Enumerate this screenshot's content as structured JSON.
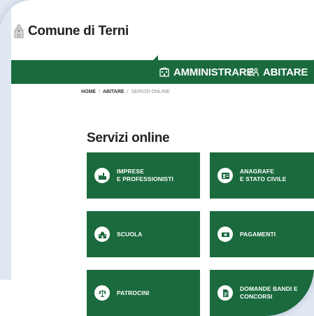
{
  "header": {
    "brand_name": "Comune di Terni"
  },
  "nav": {
    "items": [
      {
        "label": "AMMINISTRARE",
        "icon": "building-icon"
      },
      {
        "label": "ABITARE",
        "icon": "people-icon"
      }
    ]
  },
  "breadcrumb": {
    "items": [
      "HOME",
      "ABITARE",
      "SERVIZI ONLINE"
    ],
    "separator": "/"
  },
  "main": {
    "title": "Servizi online",
    "tiles": [
      {
        "line1": "IMPRESE",
        "line2": "E PROFESSIONISTI",
        "icon": "factory-icon"
      },
      {
        "line1": "ANAGRAFE",
        "line2": "E STATO CIVILE",
        "icon": "id-card-icon"
      },
      {
        "line1": "SCUOLA",
        "line2": "",
        "icon": "school-icon"
      },
      {
        "line1": "PAGAMENTI",
        "line2": "",
        "icon": "banknote-icon"
      },
      {
        "line1": "PATROCINI",
        "line2": "",
        "icon": "scales-icon"
      },
      {
        "line1": "DOMANDE BANDI E",
        "line2": "CONCORSI",
        "icon": "document-icon"
      }
    ]
  },
  "colors": {
    "primary_green": "#1a6a3d",
    "background": "#dfe7f1"
  }
}
